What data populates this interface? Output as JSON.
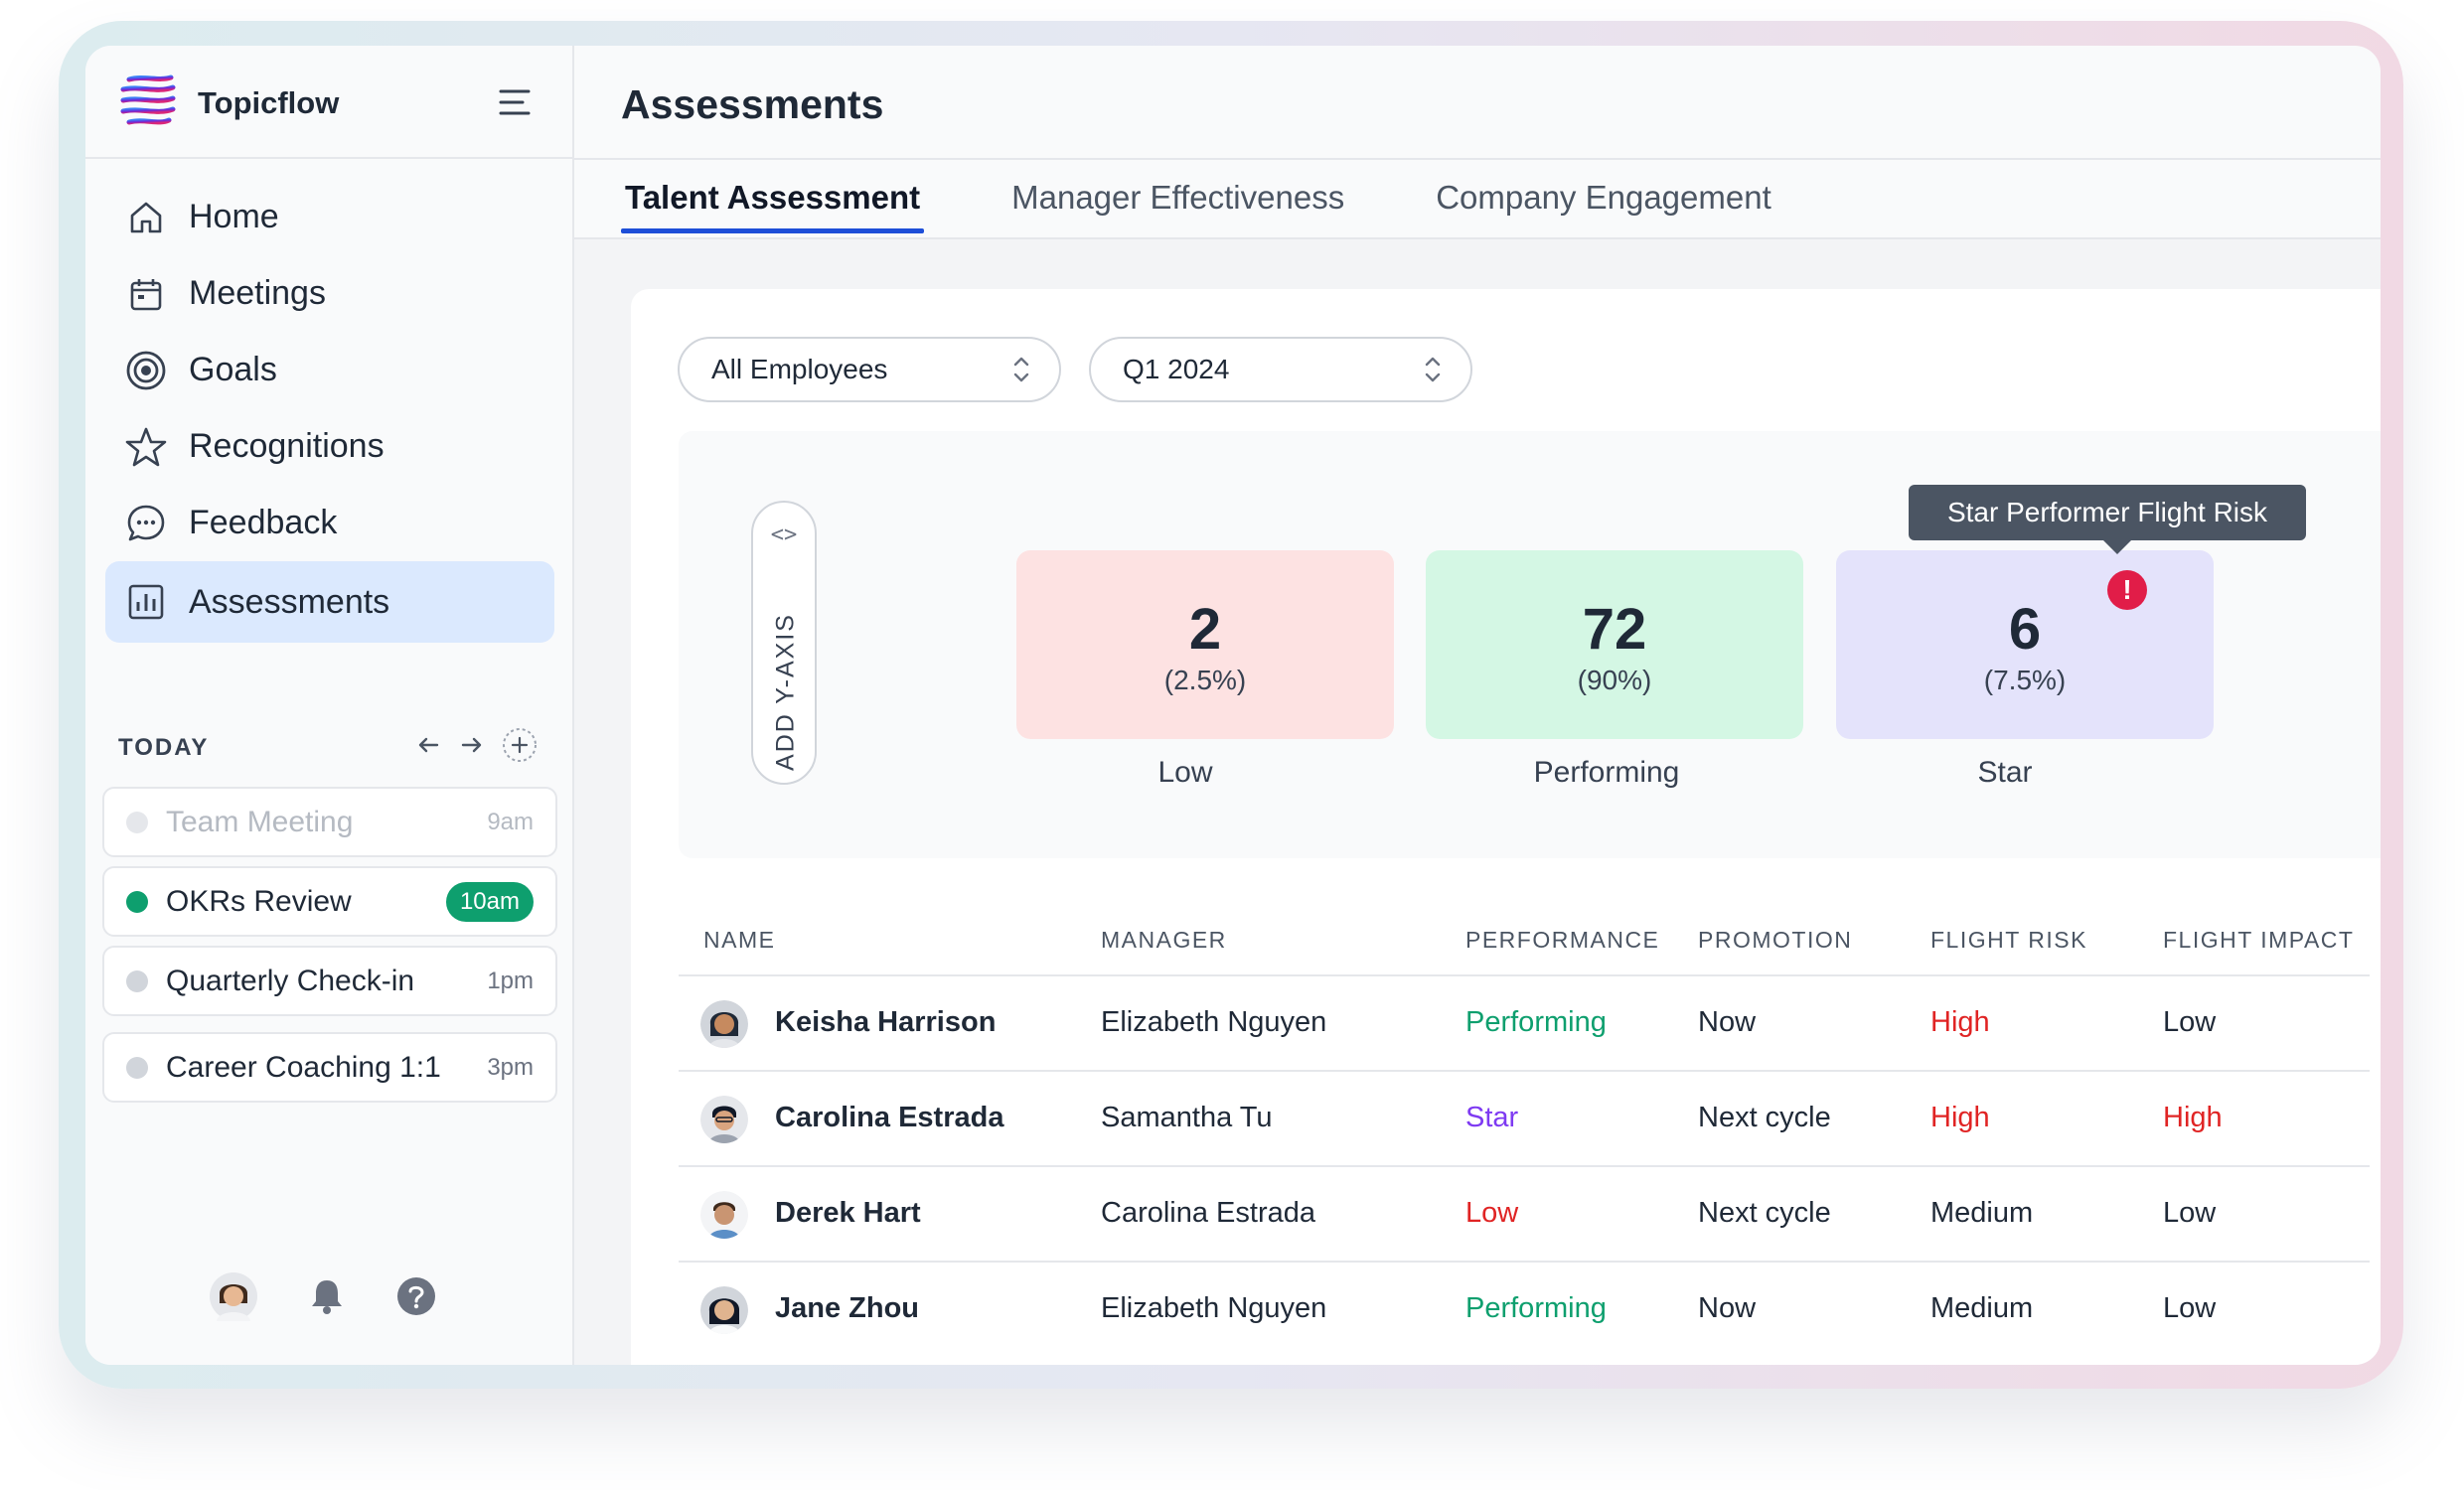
{
  "app": {
    "name": "Topicflow"
  },
  "sidebar": {
    "items": [
      {
        "label": "Home",
        "icon": "home-icon"
      },
      {
        "label": "Meetings",
        "icon": "calendar-icon"
      },
      {
        "label": "Goals",
        "icon": "target-icon"
      },
      {
        "label": "Recognitions",
        "icon": "star-icon"
      },
      {
        "label": "Feedback",
        "icon": "chat-bubble-icon"
      },
      {
        "label": "Assessments",
        "icon": "bar-chart-icon",
        "active": true
      }
    ],
    "today": {
      "header": "TODAY",
      "events": [
        {
          "title": "Team Meeting",
          "time": "9am",
          "state": "past"
        },
        {
          "title": "OKRs Review",
          "time": "10am",
          "state": "current"
        },
        {
          "title": "Quarterly Check-in",
          "time": "1pm",
          "state": "upcoming"
        },
        {
          "title": "Career Coaching 1:1",
          "time": "3pm",
          "state": "upcoming"
        }
      ]
    }
  },
  "main": {
    "title": "Assessments",
    "tabs": [
      {
        "label": "Talent Assessment",
        "active": true
      },
      {
        "label": "Manager Effectiveness"
      },
      {
        "label": "Company Engagement"
      }
    ],
    "filters": {
      "employees": "All Employees",
      "period": "Q1 2024"
    },
    "matrix": {
      "y_axis_label": "ADD Y-AXIS",
      "y_axis_code_icon": "<>",
      "tooltip": "Star Performer Flight Risk",
      "alert_glyph": "!",
      "boxes": [
        {
          "count": "2",
          "percent": "(2.5%)",
          "label": "Low",
          "color": "#fde2e2"
        },
        {
          "count": "72",
          "percent": "(90%)",
          "label": "Performing",
          "color": "#d4f7e4"
        },
        {
          "count": "6",
          "percent": "(7.5%)",
          "label": "Star",
          "color": "#e4e3fb"
        }
      ]
    },
    "table": {
      "headers": [
        "NAME",
        "MANAGER",
        "PERFORMANCE",
        "PROMOTION",
        "FLIGHT RISK",
        "FLIGHT IMPACT"
      ],
      "rows": [
        {
          "name": "Keisha Harrison",
          "manager": "Elizabeth Nguyen",
          "performance": "Performing",
          "promotion": "Now",
          "flight_risk": "High",
          "flight_impact": "Low"
        },
        {
          "name": "Carolina Estrada",
          "manager": "Samantha Tu",
          "performance": "Star",
          "promotion": "Next cycle",
          "flight_risk": "High",
          "flight_impact": "High"
        },
        {
          "name": "Derek Hart",
          "manager": "Carolina Estrada",
          "performance": "Low",
          "promotion": "Next cycle",
          "flight_risk": "Medium",
          "flight_impact": "Low"
        },
        {
          "name": "Jane Zhou",
          "manager": "Elizabeth Nguyen",
          "performance": "Performing",
          "promotion": "Now",
          "flight_risk": "Medium",
          "flight_impact": "Low"
        }
      ]
    }
  },
  "colors": {
    "accent": "#1d4ed8",
    "active_nav": "#dbe9fe",
    "success": "#0e9f6e",
    "danger": "#e02424",
    "star": "#7e3af2",
    "alert": "#e11d48"
  }
}
